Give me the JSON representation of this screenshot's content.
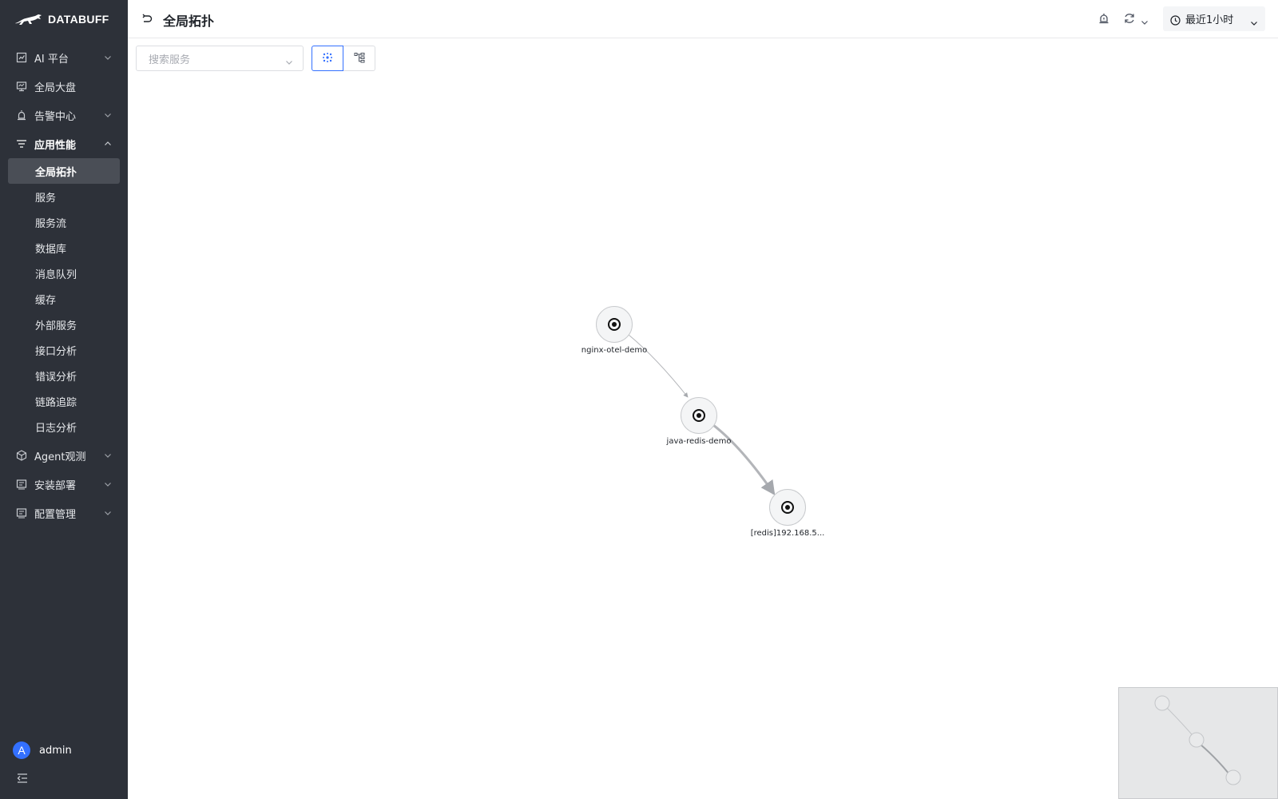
{
  "app": {
    "logo_text": "DATABUFF"
  },
  "sidebar": {
    "items": [
      {
        "label": "AI 平台",
        "icon": "chart-icon",
        "expandable": true,
        "expanded": false
      },
      {
        "label": "全局大盘",
        "icon": "monitor-icon",
        "expandable": false
      },
      {
        "label": "告警中心",
        "icon": "alarm-icon",
        "expandable": true,
        "expanded": false
      },
      {
        "label": "应用性能",
        "icon": "filter-lines-icon",
        "expandable": true,
        "expanded": true,
        "children": [
          {
            "label": "全局拓扑",
            "active": true
          },
          {
            "label": "服务"
          },
          {
            "label": "服务流"
          },
          {
            "label": "数据库"
          },
          {
            "label": "消息队列"
          },
          {
            "label": "缓存"
          },
          {
            "label": "外部服务"
          },
          {
            "label": "接口分析"
          },
          {
            "label": "错误分析"
          },
          {
            "label": "链路追踪"
          },
          {
            "label": "日志分析"
          }
        ]
      },
      {
        "label": "Agent观测",
        "icon": "cube-icon",
        "expandable": true,
        "expanded": false
      },
      {
        "label": "安装部署",
        "icon": "list-box-icon",
        "expandable": true,
        "expanded": false
      },
      {
        "label": "配置管理",
        "icon": "list-box-icon",
        "expandable": true,
        "expanded": false
      }
    ],
    "user": {
      "avatar_letter": "A",
      "name": "admin"
    }
  },
  "header": {
    "title": "全局拓扑",
    "time_range": "最近1小时"
  },
  "toolbar": {
    "search_placeholder": "搜索服务",
    "views": [
      "graph-view",
      "tree-view"
    ],
    "active_view": "graph-view"
  },
  "topology": {
    "nodes": [
      {
        "id": "n1",
        "label": "nginx-otel-demo"
      },
      {
        "id": "n2",
        "label": "java-redis-demo"
      },
      {
        "id": "n3",
        "label": "[redis]192.168.5..."
      }
    ],
    "edges": [
      {
        "from": "n1",
        "to": "n2"
      },
      {
        "from": "n2",
        "to": "n3"
      }
    ]
  },
  "colors": {
    "sidebar_bg": "#2d3139",
    "active_item_bg": "#4a4e56",
    "accent": "#3370ff"
  }
}
